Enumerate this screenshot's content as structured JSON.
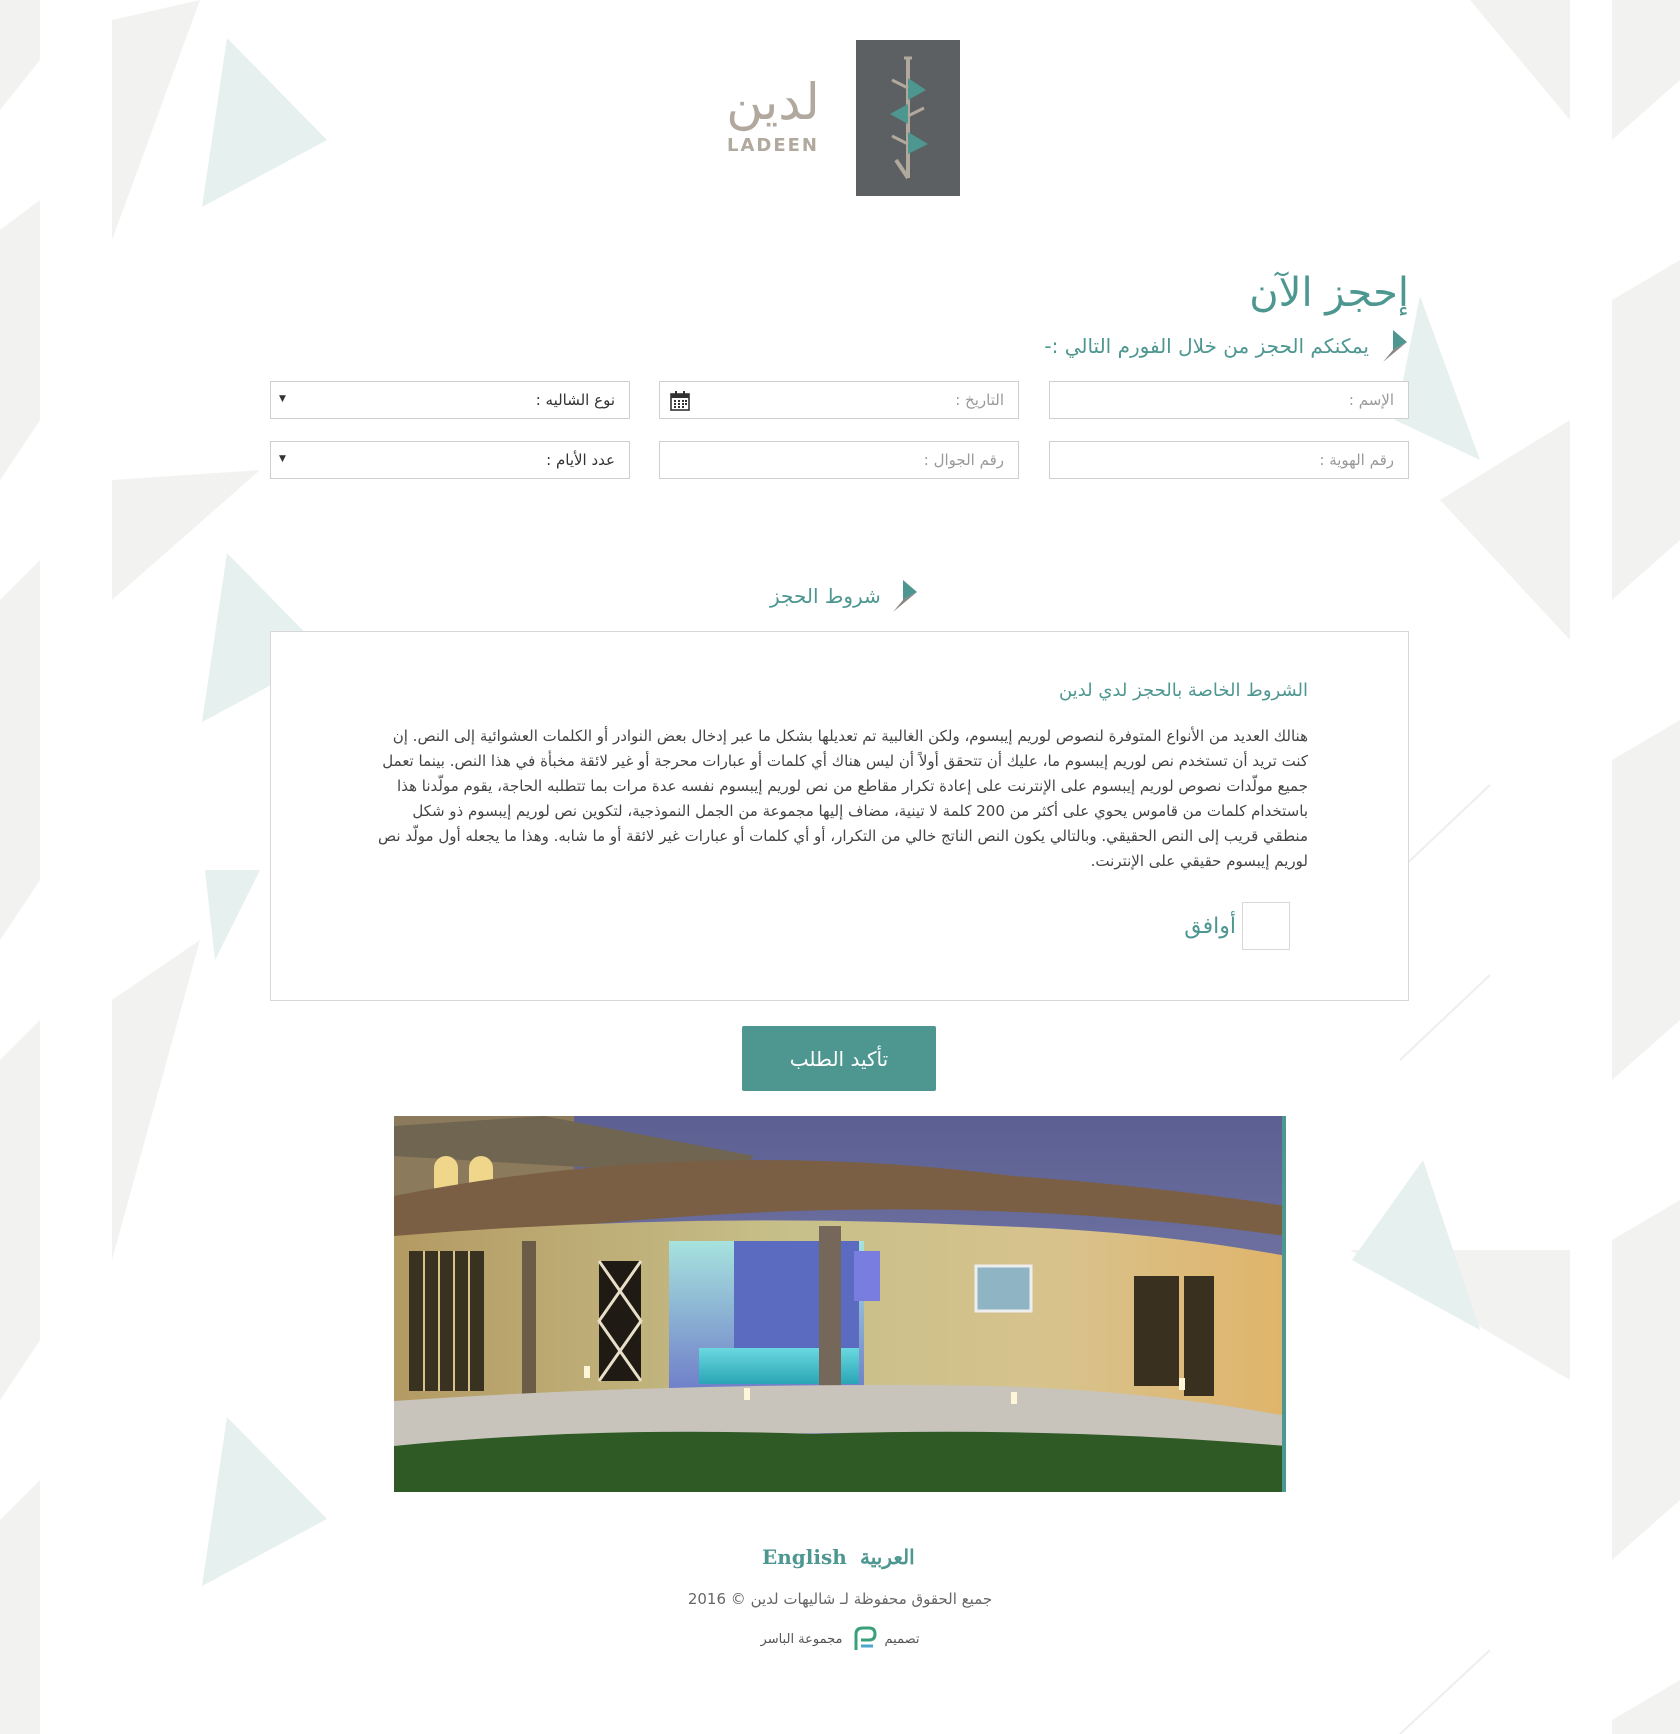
{
  "brand": {
    "name_ar": "لدين",
    "name_en": "LADEEN"
  },
  "booking": {
    "title": "إحجز الآن",
    "subtitle": "يمكنكم الحجز من خلال الفورم التالي :-",
    "name_placeholder": "الإسم :",
    "date_placeholder": "التاريخ :",
    "chalet_type_label": "نوع الشاليه :",
    "id_placeholder": "رقم الهوية :",
    "mobile_placeholder": "رقم الجوال :",
    "days_label": "عدد الأيام :"
  },
  "terms": {
    "heading": "شروط الحجز",
    "title": "الشروط الخاصة بالحجز لدي لدين",
    "body": "هنالك العديد من الأنواع المتوفرة لنصوص لوريم إيبسوم، ولكن الغالبية تم تعديلها بشكل ما عبر إدخال بعض النوادر أو الكلمات العشوائية إلى النص. إن كنت تريد أن تستخدم نص لوريم إيبسوم ما، عليك أن تتحقق أولاً أن ليس هناك أي كلمات أو عبارات محرجة أو غير لائقة مخبأة في هذا النص. بينما تعمل جميع مولّدات نصوص لوريم إيبسوم على الإنترنت على إعادة تكرار مقاطع من نص لوريم إيبسوم نفسه عدة مرات بما تتطلبه الحاجة، يقوم مولّدنا هذا باستخدام كلمات من قاموس يحوي على أكثر من 200 كلمة لا تينية، مضاف إليها مجموعة من الجمل النموذجية، لتكوين نص لوريم إيبسوم ذو شكل منطقي قريب إلى النص الحقيقي. وبالتالي يكون النص الناتج خالي من التكرار، أو أي كلمات أو عبارات غير لائقة أو ما شابه. وهذا ما يجعله أول مولّد نص لوريم إيبسوم حقيقي على الإنترنت.",
    "agree_label": "أوافق"
  },
  "confirm_button": "تأكيد الطلب",
  "footer": {
    "lang_en": "English",
    "lang_ar": "العربية",
    "copyright": "جميع الحقوق محفوظة لـ شاليهات لدين © 2016",
    "design_label": "تصميم",
    "designer": "مجموعة الباسر"
  },
  "colors": {
    "accent": "#4e9791",
    "logo_bg": "#5d6062",
    "logo_text": "#b1a89e"
  },
  "icons": {
    "calendar": "calendar-icon",
    "dropdown": "dropdown-arrow-icon",
    "heading_flag": "flag-icon"
  }
}
